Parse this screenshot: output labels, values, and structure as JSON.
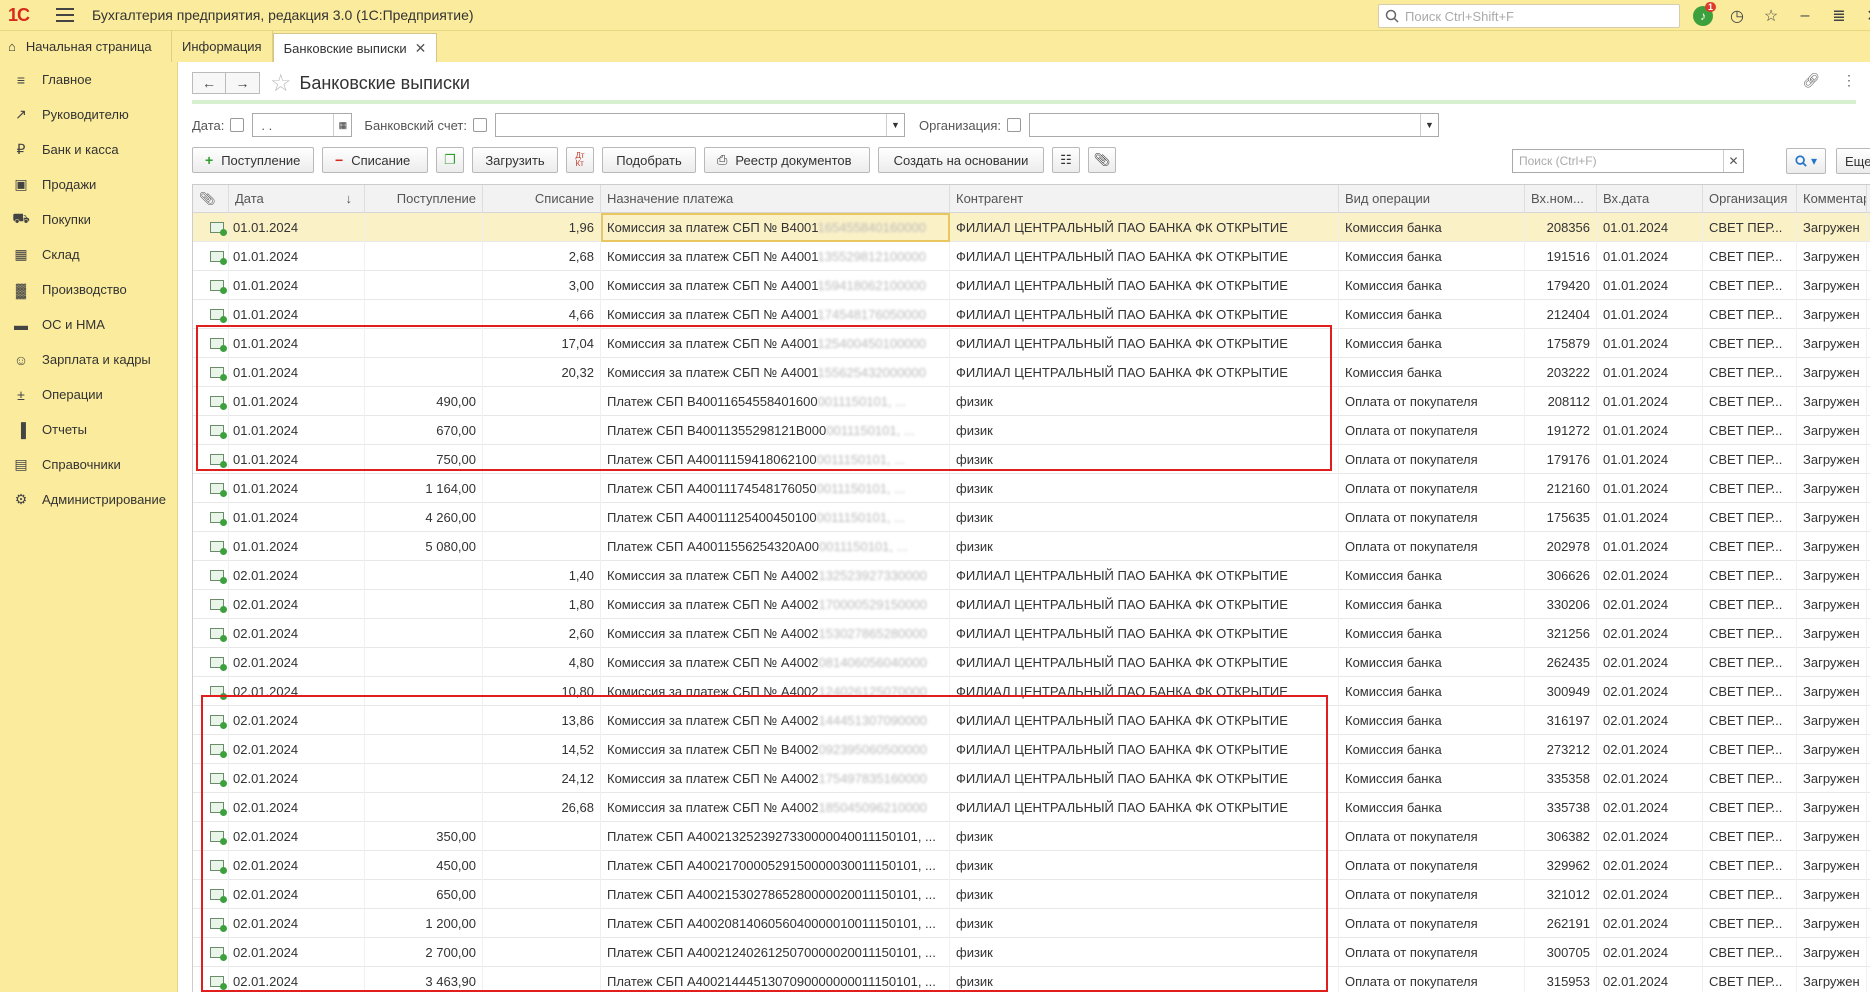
{
  "app": {
    "logo": "1С",
    "title": "Бухгалтерия предприятия, редакция 3.0  (1С:Предприятие)",
    "search_placeholder": "Поиск Ctrl+Shift+F",
    "notifications_count": "1"
  },
  "tabs": [
    {
      "label": "Начальная страница"
    },
    {
      "label": "Информация"
    },
    {
      "label": "Банковские выписки"
    }
  ],
  "sidebar": {
    "items": [
      {
        "label": "Главное",
        "icon": "menu-icon"
      },
      {
        "label": "Руководителю",
        "icon": "trend-icon"
      },
      {
        "label": "Банк и касса",
        "icon": "ruble-icon"
      },
      {
        "label": "Продажи",
        "icon": "bag-icon"
      },
      {
        "label": "Покупки",
        "icon": "cart-icon"
      },
      {
        "label": "Склад",
        "icon": "grid-icon"
      },
      {
        "label": "Производство",
        "icon": "factory-icon"
      },
      {
        "label": "ОС и НМА",
        "icon": "truck-icon"
      },
      {
        "label": "Зарплата и кадры",
        "icon": "person-icon"
      },
      {
        "label": "Операции",
        "icon": "dt-kt-icon"
      },
      {
        "label": "Отчеты",
        "icon": "chart-icon"
      },
      {
        "label": "Справочники",
        "icon": "book-icon"
      },
      {
        "label": "Администрирование",
        "icon": "gear-icon"
      }
    ]
  },
  "form": {
    "title": "Банковские выписки",
    "filters": {
      "date_label": "Дата:",
      "date_value": " .  .",
      "account_label": "Банковский счет:",
      "org_label": "Организация:"
    },
    "toolbar": {
      "income": "Поступление",
      "expense": "Списание",
      "load": "Загрузить",
      "dtkt": "Дт Кт",
      "match": "Подобрать",
      "registry": "Реестр документов",
      "create_based": "Создать на основании",
      "search_placeholder": "Поиск (Ctrl+F)",
      "more": "Еще"
    },
    "columns": [
      "",
      "Дата",
      "Поступление",
      "Списание",
      "Назначение платежа",
      "Контрагент",
      "Вид операции",
      "Вх.ном...",
      "Вх.дата",
      "Организация",
      "Комментарий"
    ],
    "rows": [
      {
        "date": "01.01.2024",
        "in": "",
        "out": "1,96",
        "purpose": "Комиссия за платеж СБП № B4001",
        "purpose_hidden": "165455840160000",
        "contr": "ФИЛИАЛ ЦЕНТРАЛЬНЫЙ ПАО БАНКА ФК ОТКРЫТИЕ",
        "op": "Комиссия банка",
        "vhnum": "208356",
        "vhdate": "01.01.2024",
        "org": "СВЕТ ПЕР...",
        "comm": "Загружен"
      },
      {
        "date": "01.01.2024",
        "in": "",
        "out": "2,68",
        "purpose": "Комиссия за платеж СБП № A4001",
        "purpose_hidden": "135529812100000",
        "contr": "ФИЛИАЛ ЦЕНТРАЛЬНЫЙ ПАО БАНКА ФК ОТКРЫТИЕ",
        "op": "Комиссия банка",
        "vhnum": "191516",
        "vhdate": "01.01.2024",
        "org": "СВЕТ ПЕР...",
        "comm": "Загружен"
      },
      {
        "date": "01.01.2024",
        "in": "",
        "out": "3,00",
        "purpose": "Комиссия за платеж СБП № A4001",
        "purpose_hidden": "159418062100000",
        "contr": "ФИЛИАЛ ЦЕНТРАЛЬНЫЙ ПАО БАНКА ФК ОТКРЫТИЕ",
        "op": "Комиссия банка",
        "vhnum": "179420",
        "vhdate": "01.01.2024",
        "org": "СВЕТ ПЕР...",
        "comm": "Загружен"
      },
      {
        "date": "01.01.2024",
        "in": "",
        "out": "4,66",
        "purpose": "Комиссия за платеж СБП № A4001",
        "purpose_hidden": "174548176050000",
        "contr": "ФИЛИАЛ ЦЕНТРАЛЬНЫЙ ПАО БАНКА ФК ОТКРЫТИЕ",
        "op": "Комиссия банка",
        "vhnum": "212404",
        "vhdate": "01.01.2024",
        "org": "СВЕТ ПЕР...",
        "comm": "Загружен"
      },
      {
        "date": "01.01.2024",
        "in": "",
        "out": "17,04",
        "purpose": "Комиссия за платеж СБП № A4001",
        "purpose_hidden": "125400450100000",
        "contr": "ФИЛИАЛ ЦЕНТРАЛЬНЫЙ ПАО БАНКА ФК ОТКРЫТИЕ",
        "op": "Комиссия банка",
        "vhnum": "175879",
        "vhdate": "01.01.2024",
        "org": "СВЕТ ПЕР...",
        "comm": "Загружен"
      },
      {
        "date": "01.01.2024",
        "in": "",
        "out": "20,32",
        "purpose": "Комиссия за платеж СБП № A4001",
        "purpose_hidden": "155625432000000",
        "contr": "ФИЛИАЛ ЦЕНТРАЛЬНЫЙ ПАО БАНКА ФК ОТКРЫТИЕ",
        "op": "Комиссия банка",
        "vhnum": "203222",
        "vhdate": "01.01.2024",
        "org": "СВЕТ ПЕР...",
        "comm": "Загружен"
      },
      {
        "date": "01.01.2024",
        "in": "490,00",
        "out": "",
        "purpose": "Платеж СБП B40011654558401600",
        "purpose_hidden": "0011150101, ...",
        "contr": "физик",
        "op": "Оплата от покупателя",
        "vhnum": "208112",
        "vhdate": "01.01.2024",
        "org": "СВЕТ ПЕР...",
        "comm": "Загружен"
      },
      {
        "date": "01.01.2024",
        "in": "670,00",
        "out": "",
        "purpose": "Платеж СБП B40011355298121B000",
        "purpose_hidden": "0011150101, ...",
        "contr": "физик",
        "op": "Оплата от покупателя",
        "vhnum": "191272",
        "vhdate": "01.01.2024",
        "org": "СВЕТ ПЕР...",
        "comm": "Загружен"
      },
      {
        "date": "01.01.2024",
        "in": "750,00",
        "out": "",
        "purpose": "Платеж СБП A40011159418062100",
        "purpose_hidden": "0011150101, ...",
        "contr": "физик",
        "op": "Оплата от покупателя",
        "vhnum": "179176",
        "vhdate": "01.01.2024",
        "org": "СВЕТ ПЕР...",
        "comm": "Загружен"
      },
      {
        "date": "01.01.2024",
        "in": "1 164,00",
        "out": "",
        "purpose": "Платеж СБП A40011174548176050",
        "purpose_hidden": "0011150101, ...",
        "contr": "физик",
        "op": "Оплата от покупателя",
        "vhnum": "212160",
        "vhdate": "01.01.2024",
        "org": "СВЕТ ПЕР...",
        "comm": "Загружен"
      },
      {
        "date": "01.01.2024",
        "in": "4 260,00",
        "out": "",
        "purpose": "Платеж СБП A40011125400450100",
        "purpose_hidden": "0011150101, ...",
        "contr": "физик",
        "op": "Оплата от покупателя",
        "vhnum": "175635",
        "vhdate": "01.01.2024",
        "org": "СВЕТ ПЕР...",
        "comm": "Загружен"
      },
      {
        "date": "01.01.2024",
        "in": "5 080,00",
        "out": "",
        "purpose": "Платеж СБП A40011556254320A00",
        "purpose_hidden": "0011150101, ...",
        "contr": "физик",
        "op": "Оплата от покупателя",
        "vhnum": "202978",
        "vhdate": "01.01.2024",
        "org": "СВЕТ ПЕР...",
        "comm": "Загружен"
      },
      {
        "date": "02.01.2024",
        "in": "",
        "out": "1,40",
        "purpose": "Комиссия за платеж СБП № A4002",
        "purpose_hidden": "132523927330000",
        "contr": "ФИЛИАЛ ЦЕНТРАЛЬНЫЙ ПАО БАНКА ФК ОТКРЫТИЕ",
        "op": "Комиссия банка",
        "vhnum": "306626",
        "vhdate": "02.01.2024",
        "org": "СВЕТ ПЕР...",
        "comm": "Загружен"
      },
      {
        "date": "02.01.2024",
        "in": "",
        "out": "1,80",
        "purpose": "Комиссия за платеж СБП № A4002",
        "purpose_hidden": "170000529150000",
        "contr": "ФИЛИАЛ ЦЕНТРАЛЬНЫЙ ПАО БАНКА ФК ОТКРЫТИЕ",
        "op": "Комиссия банка",
        "vhnum": "330206",
        "vhdate": "02.01.2024",
        "org": "СВЕТ ПЕР...",
        "comm": "Загружен"
      },
      {
        "date": "02.01.2024",
        "in": "",
        "out": "2,60",
        "purpose": "Комиссия за платеж СБП № A4002",
        "purpose_hidden": "153027865280000",
        "contr": "ФИЛИАЛ ЦЕНТРАЛЬНЫЙ ПАО БАНКА ФК ОТКРЫТИЕ",
        "op": "Комиссия банка",
        "vhnum": "321256",
        "vhdate": "02.01.2024",
        "org": "СВЕТ ПЕР...",
        "comm": "Загружен"
      },
      {
        "date": "02.01.2024",
        "in": "",
        "out": "4,80",
        "purpose": "Комиссия за платеж СБП № A4002",
        "purpose_hidden": "081406056040000",
        "contr": "ФИЛИАЛ ЦЕНТРАЛЬНЫЙ ПАО БАНКА ФК ОТКРЫТИЕ",
        "op": "Комиссия банка",
        "vhnum": "262435",
        "vhdate": "02.01.2024",
        "org": "СВЕТ ПЕР...",
        "comm": "Загружен"
      },
      {
        "date": "02.01.2024",
        "in": "",
        "out": "10,80",
        "purpose": "Комиссия за платеж СБП № A4002",
        "purpose_hidden": "124026125070000",
        "contr": "ФИЛИАЛ ЦЕНТРАЛЬНЫЙ ПАО БАНКА ФК ОТКРЫТИЕ",
        "op": "Комиссия банка",
        "vhnum": "300949",
        "vhdate": "02.01.2024",
        "org": "СВЕТ ПЕР...",
        "comm": "Загружен"
      },
      {
        "date": "02.01.2024",
        "in": "",
        "out": "13,86",
        "purpose": "Комиссия за платеж СБП № A4002",
        "purpose_hidden": "144451307090000",
        "contr": "ФИЛИАЛ ЦЕНТРАЛЬНЫЙ ПАО БАНКА ФК ОТКРЫТИЕ",
        "op": "Комиссия банка",
        "vhnum": "316197",
        "vhdate": "02.01.2024",
        "org": "СВЕТ ПЕР...",
        "comm": "Загружен"
      },
      {
        "date": "02.01.2024",
        "in": "",
        "out": "14,52",
        "purpose": "Комиссия за платеж СБП № B4002",
        "purpose_hidden": "092395060500000",
        "contr": "ФИЛИАЛ ЦЕНТРАЛЬНЫЙ ПАО БАНКА ФК ОТКРЫТИЕ",
        "op": "Комиссия банка",
        "vhnum": "273212",
        "vhdate": "02.01.2024",
        "org": "СВЕТ ПЕР...",
        "comm": "Загружен"
      },
      {
        "date": "02.01.2024",
        "in": "",
        "out": "24,12",
        "purpose": "Комиссия за платеж СБП № A4002",
        "purpose_hidden": "175497835160000",
        "contr": "ФИЛИАЛ ЦЕНТРАЛЬНЫЙ ПАО БАНКА ФК ОТКРЫТИЕ",
        "op": "Комиссия банка",
        "vhnum": "335358",
        "vhdate": "02.01.2024",
        "org": "СВЕТ ПЕР...",
        "comm": "Загружен"
      },
      {
        "date": "02.01.2024",
        "in": "",
        "out": "26,68",
        "purpose": "Комиссия за платеж СБП № A4002",
        "purpose_hidden": "185045096210000",
        "contr": "ФИЛИАЛ ЦЕНТРАЛЬНЫЙ ПАО БАНКА ФК ОТКРЫТИЕ",
        "op": "Комиссия банка",
        "vhnum": "335738",
        "vhdate": "02.01.2024",
        "org": "СВЕТ ПЕР...",
        "comm": "Загружен"
      },
      {
        "date": "02.01.2024",
        "in": "350,00",
        "out": "",
        "purpose": "Платеж СБП A4002132523927330000040011150101, ...",
        "purpose_hidden": "",
        "contr": "физик",
        "op": "Оплата от покупателя",
        "vhnum": "306382",
        "vhdate": "02.01.2024",
        "org": "СВЕТ ПЕР...",
        "comm": "Загружен"
      },
      {
        "date": "02.01.2024",
        "in": "450,00",
        "out": "",
        "purpose": "Платеж СБП A4002170000529150000030011150101, ...",
        "purpose_hidden": "",
        "contr": "физик",
        "op": "Оплата от покупателя",
        "vhnum": "329962",
        "vhdate": "02.01.2024",
        "org": "СВЕТ ПЕР...",
        "comm": "Загружен"
      },
      {
        "date": "02.01.2024",
        "in": "650,00",
        "out": "",
        "purpose": "Платеж СБП A4002153027865280000020011150101, ...",
        "purpose_hidden": "",
        "contr": "физик",
        "op": "Оплата от покупателя",
        "vhnum": "321012",
        "vhdate": "02.01.2024",
        "org": "СВЕТ ПЕР...",
        "comm": "Загружен"
      },
      {
        "date": "02.01.2024",
        "in": "1 200,00",
        "out": "",
        "purpose": "Платеж СБП A4002081406056040000010011150101, ...",
        "purpose_hidden": "",
        "contr": "физик",
        "op": "Оплата от покупателя",
        "vhnum": "262191",
        "vhdate": "02.01.2024",
        "org": "СВЕТ ПЕР...",
        "comm": "Загружен"
      },
      {
        "date": "02.01.2024",
        "in": "2 700,00",
        "out": "",
        "purpose": "Платеж СБП A4002124026125070000020011150101, ...",
        "purpose_hidden": "",
        "contr": "физик",
        "op": "Оплата от покупателя",
        "vhnum": "300705",
        "vhdate": "02.01.2024",
        "org": "СВЕТ ПЕР...",
        "comm": "Загружен"
      },
      {
        "date": "02.01.2024",
        "in": "3 463,90",
        "out": "",
        "purpose": "Платеж СБП A4002144451307090000000011150101, ...",
        "purpose_hidden": "",
        "contr": "физик",
        "op": "Оплата от покупателя",
        "vhnum": "315953",
        "vhdate": "02.01.2024",
        "org": "СВЕТ ПЕР...",
        "comm": "Загружен"
      }
    ]
  },
  "colors": {
    "accent_yellow": "#fbeb9c",
    "highlight_red": "#e01e1e",
    "selected_row": "#fbf1c7"
  }
}
